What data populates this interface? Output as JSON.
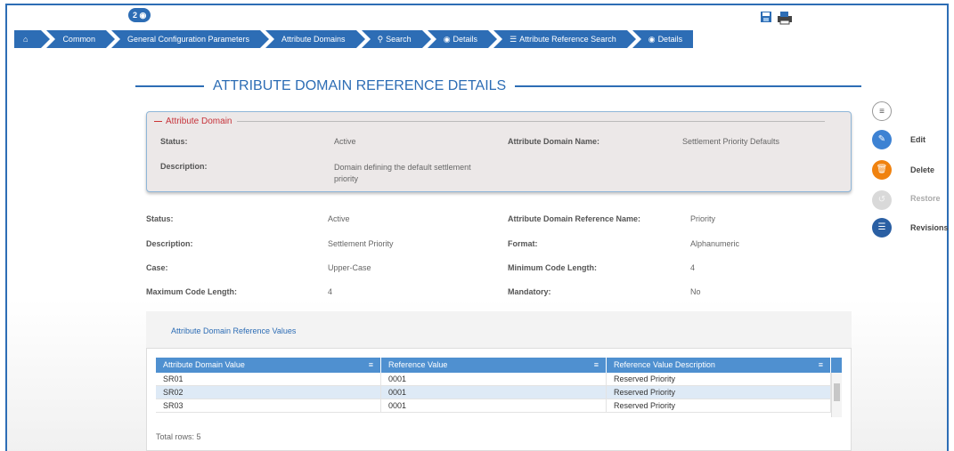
{
  "badge": "2",
  "breadcrumb": [
    {
      "label": "",
      "icon": "home-icon"
    },
    {
      "label": "Common"
    },
    {
      "label": "General Configuration Parameters"
    },
    {
      "label": "Attribute Domains"
    },
    {
      "label": "Search",
      "icon": "search-icon"
    },
    {
      "label": "Details",
      "icon": "eye-icon"
    },
    {
      "label": "Attribute Reference Search",
      "icon": "list-icon"
    },
    {
      "label": "Details",
      "icon": "eye-icon"
    }
  ],
  "page_title": "ATTRIBUTE DOMAIN REFERENCE DETAILS",
  "domain": {
    "legend": "Attribute Domain",
    "status_label": "Status:",
    "status_value": "Active",
    "name_label": "Attribute Domain Name:",
    "name_value": "Settlement Priority Defaults",
    "desc_label": "Description:",
    "desc_value": "Domain defining the default settlement priority"
  },
  "details": {
    "status_label": "Status:",
    "status_value": "Active",
    "refname_label": "Attribute Domain Reference Name:",
    "refname_value": "Priority",
    "desc_label": "Description:",
    "desc_value": "Settlement Priority",
    "format_label": "Format:",
    "format_value": "Alphanumeric",
    "case_label": "Case:",
    "case_value": "Upper-Case",
    "mincode_label": "Minimum Code Length:",
    "mincode_value": "4",
    "maxcode_label": "Maximum Code Length:",
    "maxcode_value": "4",
    "mandatory_label": "Mandatory:",
    "mandatory_value": "No"
  },
  "actions": {
    "edit": "Edit",
    "delete": "Delete",
    "restore": "Restore",
    "revisions": "Revisions"
  },
  "values_section": {
    "title": "Attribute Domain Reference Values",
    "columns": [
      "Attribute Domain Value",
      "Reference Value",
      "Reference Value Description"
    ],
    "rows": [
      [
        "SR01",
        "0001",
        "Reserved Priority"
      ],
      [
        "SR02",
        "0001",
        "Reserved Priority"
      ],
      [
        "SR03",
        "0001",
        "Reserved Priority"
      ]
    ],
    "total": "Total rows: 5"
  },
  "colors": {
    "accent": "#2d6db5",
    "grid_header": "#4f90d0",
    "delete": "#f0820f",
    "legend": "#c6333b"
  }
}
